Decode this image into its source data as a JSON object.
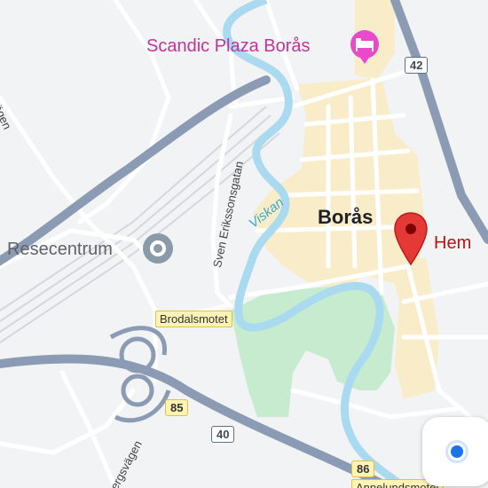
{
  "map": {
    "city": "Borås",
    "hotel": "Scandic Plaza Borås",
    "station": "Resecentrum",
    "home": "Hem",
    "street_eriksons": "Sven Erikssonsgatan",
    "street_partial_top": "vägen",
    "street_partial_bottom": "ergsvägen",
    "river": "Viskan",
    "junction_brodal": "Brodalsmotet",
    "junction_bottom": "Annelundsmotet",
    "routes": {
      "r42": "42",
      "r85": "85",
      "r40": "40",
      "r86": "86"
    }
  },
  "icons": {
    "hotel": "hotel-bed-icon",
    "station": "transit-station-icon",
    "home": "red-location-pin-icon",
    "location": "my-location-icon"
  },
  "colors": {
    "background": "#f1f3f4",
    "downtown": "#f8ecc9",
    "park": "#c6ebcf",
    "river": "#aadaf0",
    "highway": "#8b9bb4",
    "pin": "#e53935",
    "hotel_pink": "#e84acb",
    "location_blue": "#1a73e8"
  }
}
